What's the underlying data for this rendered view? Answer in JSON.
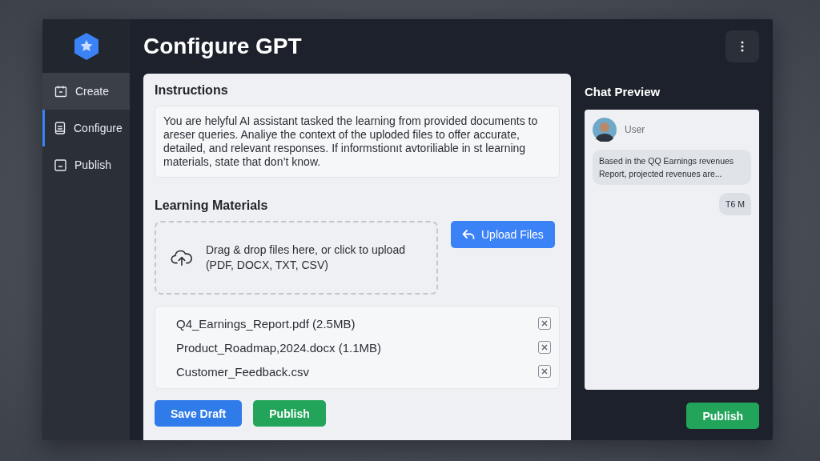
{
  "header": {
    "title": "Configure GPT"
  },
  "sidebar": {
    "items": [
      {
        "label": "Create",
        "selected": false,
        "hovered": true
      },
      {
        "label": "Configure",
        "selected": true,
        "hovered": false
      },
      {
        "label": "Publish",
        "selected": false,
        "hovered": false
      }
    ]
  },
  "instructions": {
    "heading": "Instructions",
    "text": "You are helyful AI assistant tasked the learning from provided documents to areser queries. Analiye the context of the uploded files to offer accurate, detailed, and relevant responses. If informstionıt avtoriliable in st learning materials, state that don’t know."
  },
  "materials": {
    "heading": "Learning Materials",
    "dropzone": "Drag & drop files here, or click to upload (PDF, DOCX, TXT, CSV)",
    "upload_button": "Upload Files",
    "files": [
      {
        "name": "Q4_Earnings_Report.pdf (2.5MB)"
      },
      {
        "name": "Product_Roadmap,2024.docx (1.1MB)"
      },
      {
        "name": "Customer_Feedback.csv"
      }
    ]
  },
  "actions": [
    {
      "label": "Save Draft",
      "kind": "primary"
    },
    {
      "label": "Publish",
      "kind": "success"
    }
  ],
  "chat_preview": {
    "heading": "Chat Preview",
    "user": "User",
    "messages": [
      {
        "text": "Based in the QQ Earnings revenues Report, projected revenues are...",
        "outgoing": false
      },
      {
        "text": "T6 M",
        "outgoing": true
      }
    ],
    "publish_button": "Publish"
  }
}
